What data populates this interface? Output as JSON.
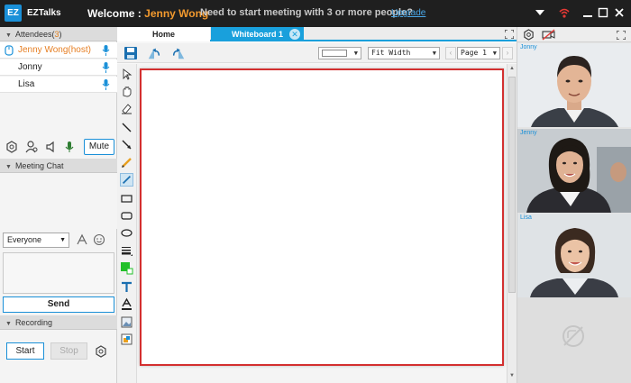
{
  "titlebar": {
    "logo": "EZ",
    "app_name": "EZTalks",
    "welcome_prefix": "Welcome :",
    "user_name": "Jenny Wong",
    "promo": "Need to start meeting with 3 or more people?",
    "upgrade": "Upgrade"
  },
  "attendees": {
    "label": "Attendees(",
    "count": "3",
    "close": ")",
    "list": [
      {
        "name": "Jenny Wong(host)"
      },
      {
        "name": "Jonny"
      },
      {
        "name": "Lisa"
      }
    ],
    "mute_label": "Mute"
  },
  "chat": {
    "header": "Meeting Chat",
    "recipient": "Everyone",
    "send_label": "Send"
  },
  "recording": {
    "header": "Recording",
    "start_label": "Start",
    "stop_label": "Stop"
  },
  "tabs": [
    {
      "label": "Home"
    },
    {
      "label": "Whiteboard 1"
    }
  ],
  "wb_toolbar": {
    "color_value": "",
    "fit": "Fit Width",
    "page": "Page 1"
  },
  "videos": [
    {
      "name": "Jonny"
    },
    {
      "name": "Jenny"
    },
    {
      "name": "Lisa"
    }
  ],
  "colors": {
    "accent": "#19a0dc",
    "host": "#e67e22",
    "canvas_border": "#d32f2f",
    "titlebar": "#1f1f1f"
  }
}
